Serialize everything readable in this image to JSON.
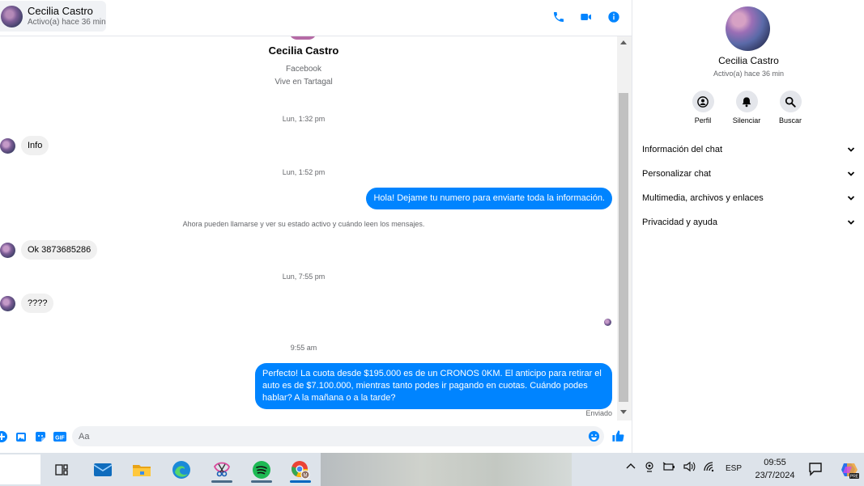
{
  "header": {
    "name": "Cecilia Castro",
    "status": "Activo(a) hace 36 min",
    "accent": "#0084ff"
  },
  "profile": {
    "name": "Cecilia Castro",
    "source": "Facebook",
    "location": "Vive en Tartagal"
  },
  "messages": {
    "ts1": "Lun, 1:32 pm",
    "in1": "Info",
    "ts2": "Lun, 1:52 pm",
    "out1": "Hola! Dejame tu numero  para enviarte toda la información.",
    "notice": "Ahora pueden llamarse y ver su estado activo y cuándo leen los mensajes.",
    "in2": "Ok 3873685286",
    "ts3": "Lun, 7:55 pm",
    "in3": "????",
    "ts4": "9:55 am",
    "out2": "Perfecto! La cuota desde $195.000 es de un CRONOS 0KM. El anticipo para retirar el auto es de $7.100.000, mientras tanto podes ir pagando en cuotas. Cuándo podes hablar? A la mañana o a la tarde?",
    "sent": "Enviado"
  },
  "composer": {
    "placeholder": "Aa",
    "gif_label": "GIF"
  },
  "right_panel": {
    "name": "Cecilia Castro",
    "status": "Activo(a) hace 36 min",
    "actions": [
      {
        "label": "Perfil",
        "icon": "profile-icon"
      },
      {
        "label": "Silenciar",
        "icon": "bell-icon"
      },
      {
        "label": "Buscar",
        "icon": "search-icon"
      }
    ],
    "sections": [
      "Información del chat",
      "Personalizar chat",
      "Multimedia, archivos y enlaces",
      "Privacidad y ayuda"
    ]
  },
  "taskbar": {
    "language": "ESP",
    "time": "09:55",
    "date": "23/7/2024",
    "copilot_badge": "PRE"
  }
}
